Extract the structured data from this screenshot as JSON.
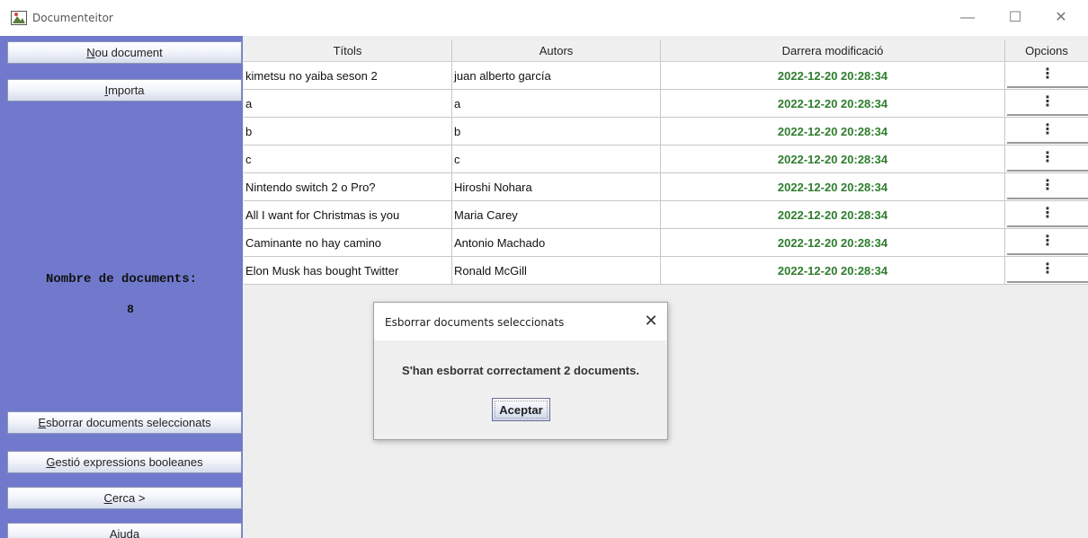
{
  "window": {
    "title": "Documenteitor",
    "controls": {
      "minimize": "—",
      "maximize": "☐",
      "close": "✕"
    }
  },
  "sidebar": {
    "new_doc": {
      "mnemonic": "N",
      "rest": "ou document"
    },
    "import": {
      "mnemonic": "I",
      "rest": "mporta"
    },
    "docs_label": "Nombre de documents:",
    "docs_count": "8",
    "delete_selected": {
      "mnemonic": "E",
      "rest": "sborrar documents seleccionats"
    },
    "bool_expr": {
      "mnemonic": "G",
      "rest": "estió expressions booleanes"
    },
    "search": {
      "mnemonic": "C",
      "rest": "erca >"
    },
    "help": "Ajuda"
  },
  "table": {
    "headers": [
      "Títols",
      "Autors",
      "Darrera modificació",
      "Opcions"
    ],
    "rows": [
      {
        "title": "kimetsu no yaiba seson 2",
        "author": "juan alberto garcía",
        "date": "2022-12-20 20:28:34",
        "option": "⋮"
      },
      {
        "title": "a",
        "author": "a",
        "date": "2022-12-20 20:28:34",
        "option": "⋮"
      },
      {
        "title": "b",
        "author": "b",
        "date": "2022-12-20 20:28:34",
        "option": "⋮"
      },
      {
        "title": "c",
        "author": "c",
        "date": "2022-12-20 20:28:34",
        "option": "⋮"
      },
      {
        "title": "Nintendo switch 2 o Pro?",
        "author": "Hiroshi Nohara",
        "date": "2022-12-20 20:28:34",
        "option": "⋮"
      },
      {
        "title": "All I want for Christmas is you",
        "author": "Maria Carey",
        "date": "2022-12-20 20:28:34",
        "option": "⋮"
      },
      {
        "title": "Caminante no hay camino",
        "author": "Antonio Machado",
        "date": "2022-12-20 20:28:34",
        "option": "⋮"
      },
      {
        "title": "Elon Musk has bought Twitter",
        "author": "Ronald McGill",
        "date": "2022-12-20 20:28:34",
        "option": "⋮"
      }
    ]
  },
  "dialog": {
    "title": "Esborrar documents seleccionats",
    "close": "✕",
    "message": "S'han esborrat correctament 2 documents.",
    "ok_label": "Aceptar"
  }
}
